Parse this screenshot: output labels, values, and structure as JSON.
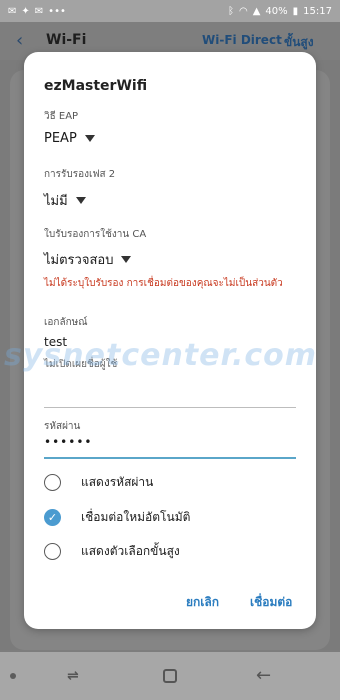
{
  "status_bar": {
    "time": "15:17",
    "battery": "40%",
    "left_icons": [
      "messages-icon",
      "twitter-icon",
      "email-icon",
      "ellipsis-icon"
    ],
    "right_icons": [
      "bluetooth-icon",
      "wifi-icon",
      "signal-icon",
      "battery-icon"
    ]
  },
  "app_bar": {
    "title": "Wi-Fi",
    "wifi_direct": "Wi-Fi Direct",
    "advanced": "ขั้นสูง"
  },
  "dialog": {
    "title": "ezMasterWifi",
    "eap_label": "วิธี EAP",
    "eap_value": "PEAP",
    "phase2_label": "การรับรองเฟส 2",
    "phase2_value": "ไม่มี",
    "ca_label": "ใบรับรองการใช้งาน CA",
    "ca_value": "ไม่ตรวจสอบ",
    "ca_warning": "ไม่ได้ระบุใบรับรอง การเชื่อมต่อของคุณจะไม่เป็นส่วนตัว",
    "identity_label": "เอกลักษณ์",
    "identity_value": "test",
    "anon_identity_placeholder": "ไม่เปิดเผยชื่อผู้ใช้",
    "password_label": "รหัสผ่าน",
    "password_value": "••••••",
    "options": [
      {
        "label": "แสดงรหัสผ่าน",
        "checked": false
      },
      {
        "label": "เชื่อมต่อใหม่อัตโนมัติ",
        "checked": true
      },
      {
        "label": "แสดงตัวเลือกขั้นสูง",
        "checked": false
      }
    ],
    "cancel": "ยกเลิก",
    "connect": "เชื่อมต่อ"
  },
  "watermark": "sysnetcenter.com",
  "colors": {
    "accent": "#4b9bd0",
    "button_text": "#2a7cbf",
    "warning": "#c8391f",
    "focus_underline": "#5aa6c9"
  }
}
